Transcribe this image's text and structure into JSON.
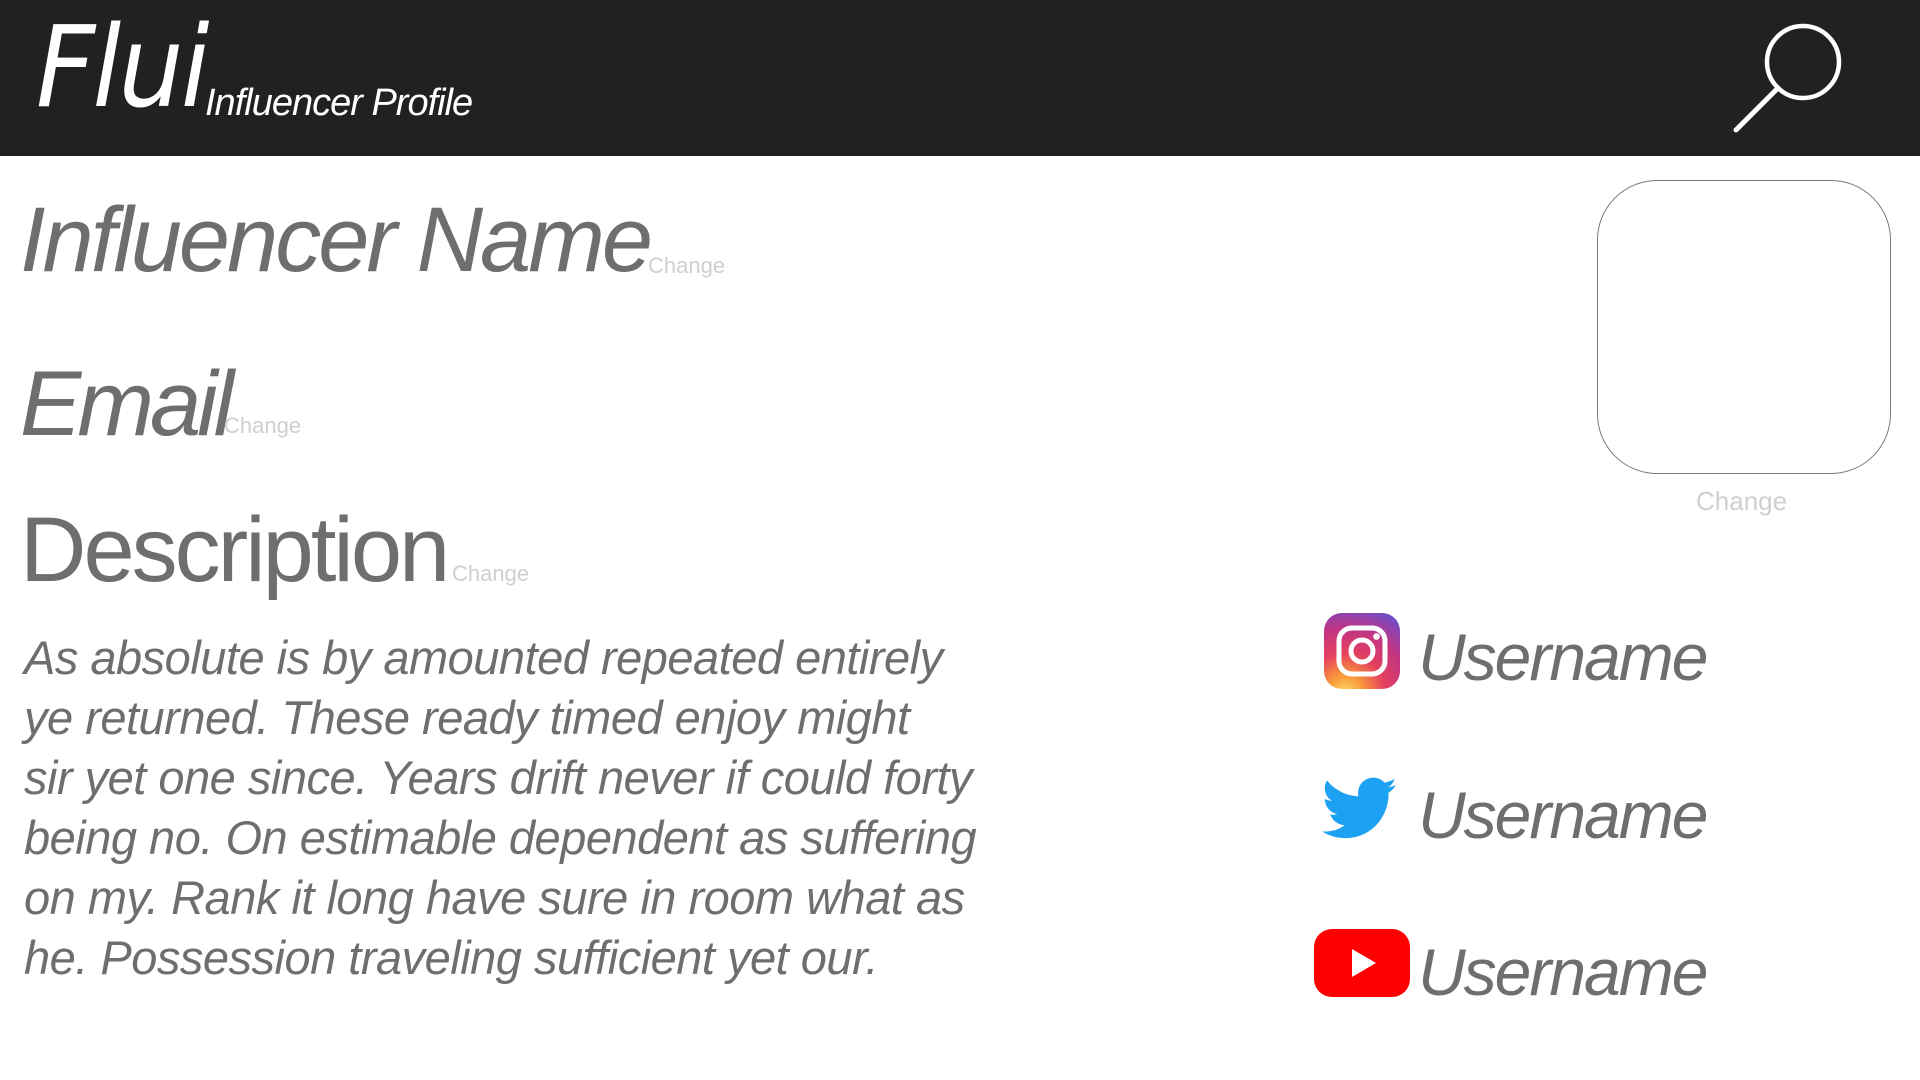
{
  "header": {
    "brand": "Flui",
    "subtitle": "Influencer Profile",
    "search_icon": "search-icon",
    "background_color": "#212121"
  },
  "profile": {
    "name_label": "Influencer Name",
    "email_label": "Email",
    "description_label": "Description",
    "change_label": "Change",
    "description_lines": [
      "As absolute is by amounted repeated entirely",
      "ye returned. These ready timed enjoy might",
      "sir yet one since. Years drift never if could forty",
      "being no. On estimable dependent as suffering",
      "on my. Rank it long have sure in room what as",
      "he. Possession traveling sufficient yet our."
    ]
  },
  "avatar": {
    "change_label": "Change"
  },
  "socials": [
    {
      "platform": "instagram",
      "icon": "instagram-icon",
      "username": "Username"
    },
    {
      "platform": "twitter",
      "icon": "twitter-icon",
      "username": "Username"
    },
    {
      "platform": "youtube",
      "icon": "youtube-icon",
      "username": "Username",
      "color": "#ff0000"
    }
  ]
}
